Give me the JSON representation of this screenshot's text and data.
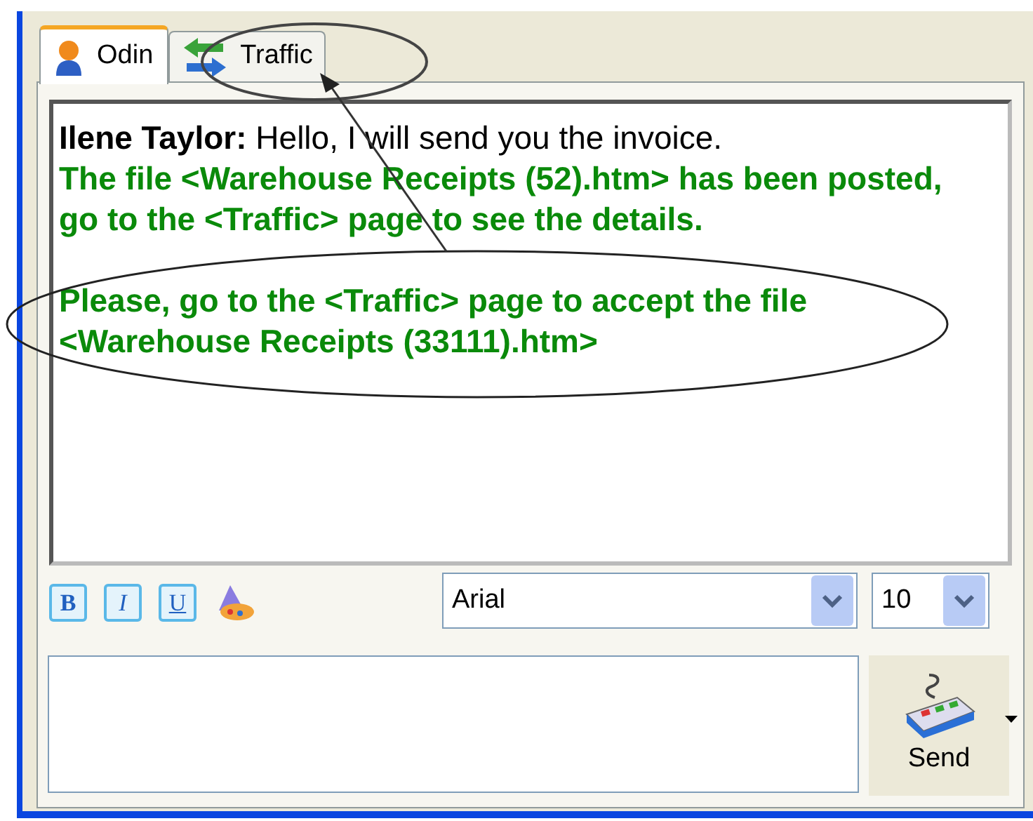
{
  "tabs": [
    {
      "label": "Odin",
      "selected": true
    },
    {
      "label": "Traffic",
      "selected": false
    }
  ],
  "messages": [
    {
      "kind": "chat",
      "sender": "Ilene Taylor:",
      "text": "Hello, I will send you the invoice."
    },
    {
      "kind": "system",
      "text": "The file <Warehouse Receipts (52).htm> has been posted, go to the <Traffic> page to see the details."
    },
    {
      "kind": "gap"
    },
    {
      "kind": "system",
      "text": "Please, go to the <Traffic> page to accept the file <Warehouse Receipts (33111).htm>"
    }
  ],
  "format_buttons": [
    {
      "kind": "bold",
      "label": "B"
    },
    {
      "kind": "italic",
      "label": "I"
    },
    {
      "kind": "underline",
      "label": "U"
    },
    {
      "kind": "color"
    }
  ],
  "font_select": {
    "value": "Arial"
  },
  "size_select": {
    "value": "10"
  },
  "send_button": {
    "label": "Send"
  }
}
